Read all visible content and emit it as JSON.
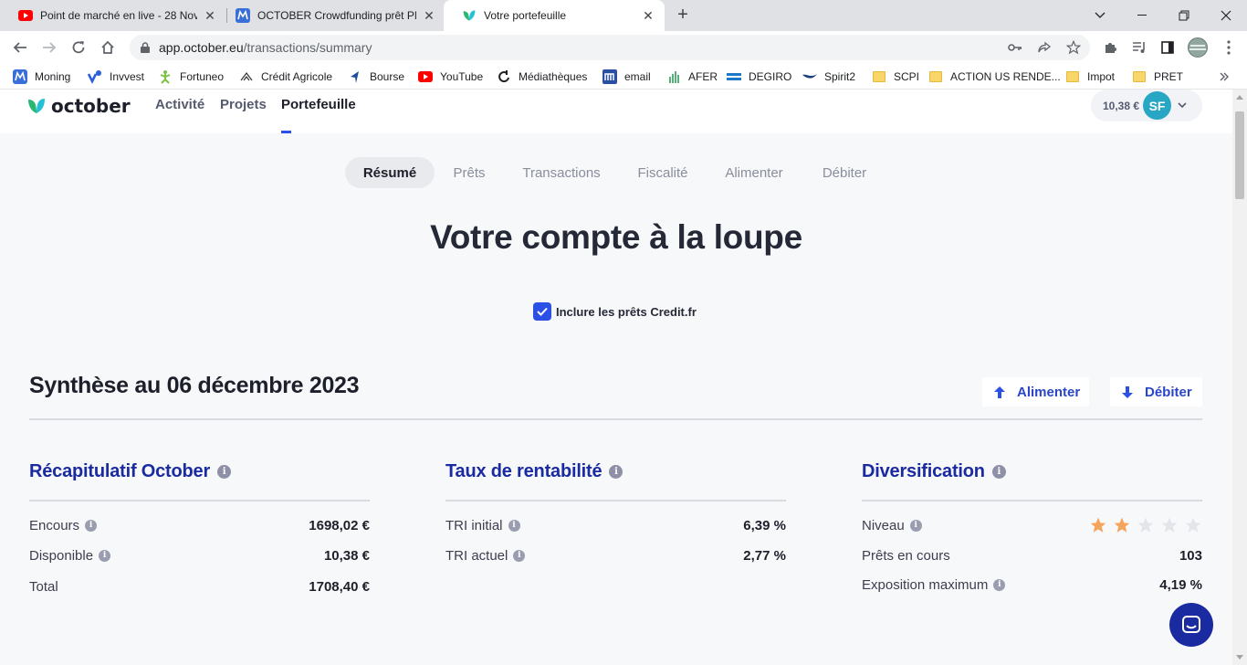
{
  "browser": {
    "tabs": [
      {
        "title": "Point de marché en live - 28 Nov",
        "icon": "youtube-icon"
      },
      {
        "title": "OCTOBER Crowdfunding prêt PME",
        "icon": "moning-icon"
      },
      {
        "title": "Votre portefeuille",
        "icon": "october-leaf-icon"
      }
    ],
    "url_host": "app.october.eu",
    "url_path": "/transactions/summary",
    "bookmarks": [
      {
        "label": "Moning",
        "icon": "moning-icon"
      },
      {
        "label": "Invvest",
        "icon": "invvest-icon"
      },
      {
        "label": "Fortuneo",
        "icon": "fortuneo-icon"
      },
      {
        "label": "Crédit Agricole",
        "icon": "credit-agricole-icon"
      },
      {
        "label": "Bourse",
        "icon": "bourse-icon"
      },
      {
        "label": "YouTube",
        "icon": "youtube-icon"
      },
      {
        "label": "Médiathèques",
        "icon": "mediatheques-icon"
      },
      {
        "label": "email",
        "icon": "email-icon"
      },
      {
        "label": "AFER",
        "icon": "afer-icon"
      },
      {
        "label": "DEGIRO",
        "icon": "degiro-icon"
      },
      {
        "label": "Spirit2",
        "icon": "spirit2-icon"
      },
      {
        "label": "SCPI",
        "icon": "folder-icon"
      },
      {
        "label": "ACTION US RENDE...",
        "icon": "folder-icon"
      },
      {
        "label": "Impot",
        "icon": "folder-icon"
      },
      {
        "label": "PRET",
        "icon": "folder-icon"
      }
    ]
  },
  "app": {
    "brand": "october",
    "nav": [
      {
        "label": "Activité"
      },
      {
        "label": "Projets"
      },
      {
        "label": "Portefeuille"
      }
    ],
    "active_nav": "Portefeuille",
    "account": {
      "balance": "10,38 €",
      "initials": "SF"
    }
  },
  "subtabs": [
    {
      "label": "Résumé"
    },
    {
      "label": "Prêts"
    },
    {
      "label": "Transactions"
    },
    {
      "label": "Fiscalité"
    },
    {
      "label": "Alimenter"
    },
    {
      "label": "Débiter"
    }
  ],
  "active_subtab": "Résumé",
  "title": "Votre compte à la loupe",
  "include_checkbox": {
    "label": "Inclure les prêts Credit.fr",
    "checked": true
  },
  "synthesis": {
    "title": "Synthèse au 06 décembre 2023",
    "alimenter_label": "Alimenter",
    "debiter_label": "Débiter"
  },
  "recap": {
    "title": "Récapitulatif October",
    "rows": [
      {
        "label": "Encours",
        "value": "1698,02 €"
      },
      {
        "label": "Disponible",
        "value": "10,38 €"
      },
      {
        "label": "Total",
        "value": "1708,40 €"
      }
    ]
  },
  "rentabilite": {
    "title": "Taux de rentabilité",
    "rows": [
      {
        "label": "TRI initial",
        "value": "6,39 %"
      },
      {
        "label": "TRI actuel",
        "value": "2,77 %"
      }
    ]
  },
  "diversification": {
    "title": "Diversification",
    "niveau_label": "Niveau",
    "stars_filled": 2,
    "stars_total": 5,
    "rows": [
      {
        "label": "Prêts en cours",
        "value": "103"
      },
      {
        "label": "Exposition maximum",
        "value": "4,19 %"
      }
    ]
  },
  "colors": {
    "accent_blue": "#2a50e6",
    "heading_navy": "#1a2aa0",
    "star_filled": "#f6a35b",
    "star_empty": "#e3e5ea",
    "avatar": "#28a7c4"
  }
}
